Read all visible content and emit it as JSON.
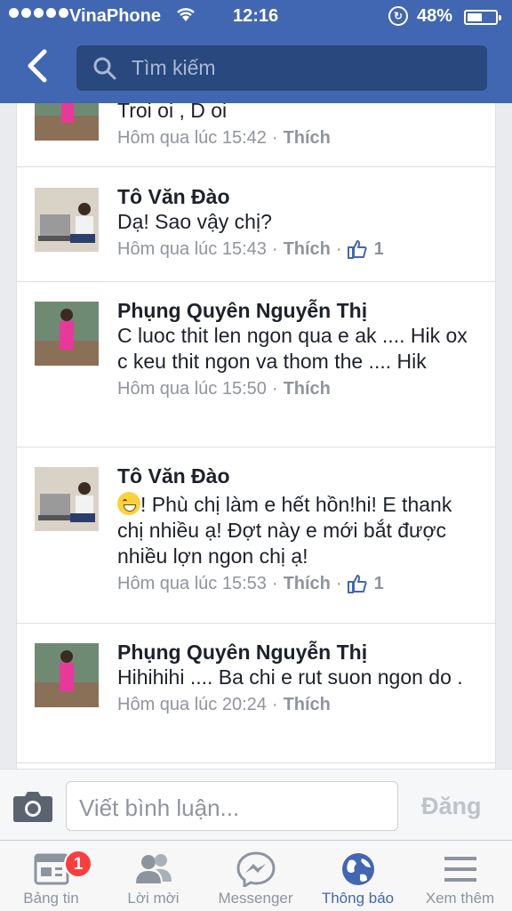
{
  "status_bar": {
    "carrier": "VinaPhone",
    "time": "12:16",
    "battery": "48%"
  },
  "header": {
    "search_placeholder": "Tìm kiếm"
  },
  "comments": [
    {
      "author": "",
      "text": "Troi oi , D oi",
      "time": "Hôm qua lúc 15:42",
      "like_label": "Thích",
      "likes": ""
    },
    {
      "author": "Tô Văn Đào",
      "text": "Dạ! Sao vậy chị?",
      "time": "Hôm qua lúc 15:43",
      "like_label": "Thích",
      "likes": "1"
    },
    {
      "author": "Phụng Quyên Nguyễn Thị",
      "text": "C luoc thit len ngon qua e ak .... Hik ox c keu thit ngon va thom the .... Hik",
      "time": "Hôm qua lúc 15:50",
      "like_label": "Thích",
      "likes": ""
    },
    {
      "author": "Tô Văn Đào",
      "text": "! Phù chị làm e hết hồn!hi! E thank chị nhiều ạ! Đợt này e mới bắt được nhiều lợn ngon chị ạ!",
      "time": "Hôm qua lúc 15:53",
      "like_label": "Thích",
      "likes": "1"
    },
    {
      "author": "Phụng Quyên Nguyễn Thị",
      "text": "Hihihihi .... Ba chi e rut suon ngon do .",
      "time": "Hôm qua lúc 20:24",
      "like_label": "Thích",
      "likes": ""
    }
  ],
  "composer": {
    "placeholder": "Viết bình luận...",
    "post_label": "Đăng"
  },
  "tabs": [
    {
      "label": "Bảng tin",
      "icon": "news-feed-icon",
      "badge": "1"
    },
    {
      "label": "Lời mời",
      "icon": "friend-requests-icon"
    },
    {
      "label": "Messenger",
      "icon": "messenger-icon"
    },
    {
      "label": "Thông báo",
      "icon": "globe-icon",
      "active": true
    },
    {
      "label": "Xem thêm",
      "icon": "menu-icon"
    }
  ],
  "colors": {
    "brand": "#4267b2",
    "text": "#1d2129",
    "meta": "#90949c",
    "badge": "#fa3e3e"
  }
}
